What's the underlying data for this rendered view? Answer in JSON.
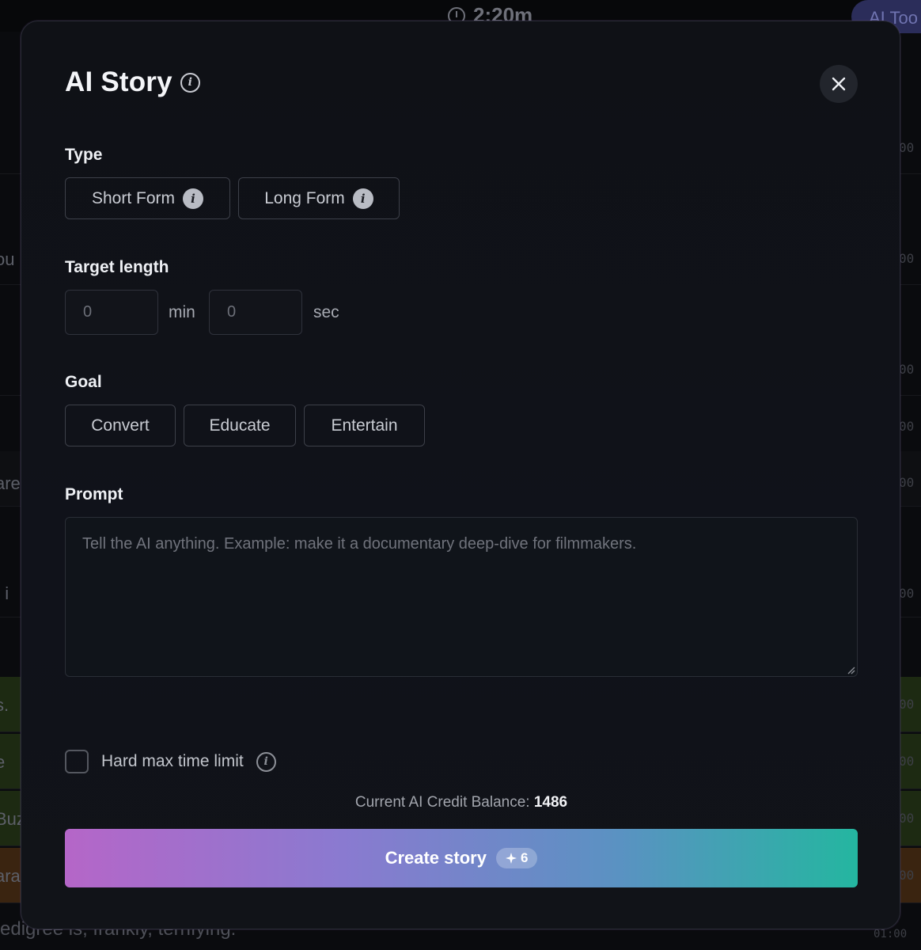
{
  "background": {
    "timer": "2:20m",
    "ai_tools_label": "AI Too",
    "left_fragments": [
      "ou",
      "are",
      "t i",
      "s.",
      "e",
      "Buz",
      "ara"
    ],
    "bottom_text": "edigree is, frankly, terrifying.",
    "right_fragments": [
      "00",
      "00",
      "00",
      "00",
      "00",
      "00",
      "00",
      "00",
      "00",
      "00"
    ],
    "bottom_num": "01:00"
  },
  "modal": {
    "title": "AI Story",
    "type": {
      "label": "Type",
      "options": [
        {
          "label": "Short Form"
        },
        {
          "label": "Long Form"
        }
      ]
    },
    "target_length": {
      "label": "Target length",
      "min_placeholder": "0",
      "min_unit": "min",
      "sec_placeholder": "0",
      "sec_unit": "sec"
    },
    "goal": {
      "label": "Goal",
      "options": [
        {
          "label": "Convert"
        },
        {
          "label": "Educate"
        },
        {
          "label": "Entertain"
        }
      ]
    },
    "prompt": {
      "label": "Prompt",
      "placeholder": "Tell the AI anything. Example: make it a documentary deep-dive for filmmakers."
    },
    "hard_limit_label": "Hard max time limit",
    "credit_label": "Current AI Credit Balance:",
    "credit_value": "1486",
    "create_label": "Create story",
    "create_cost": "6"
  }
}
